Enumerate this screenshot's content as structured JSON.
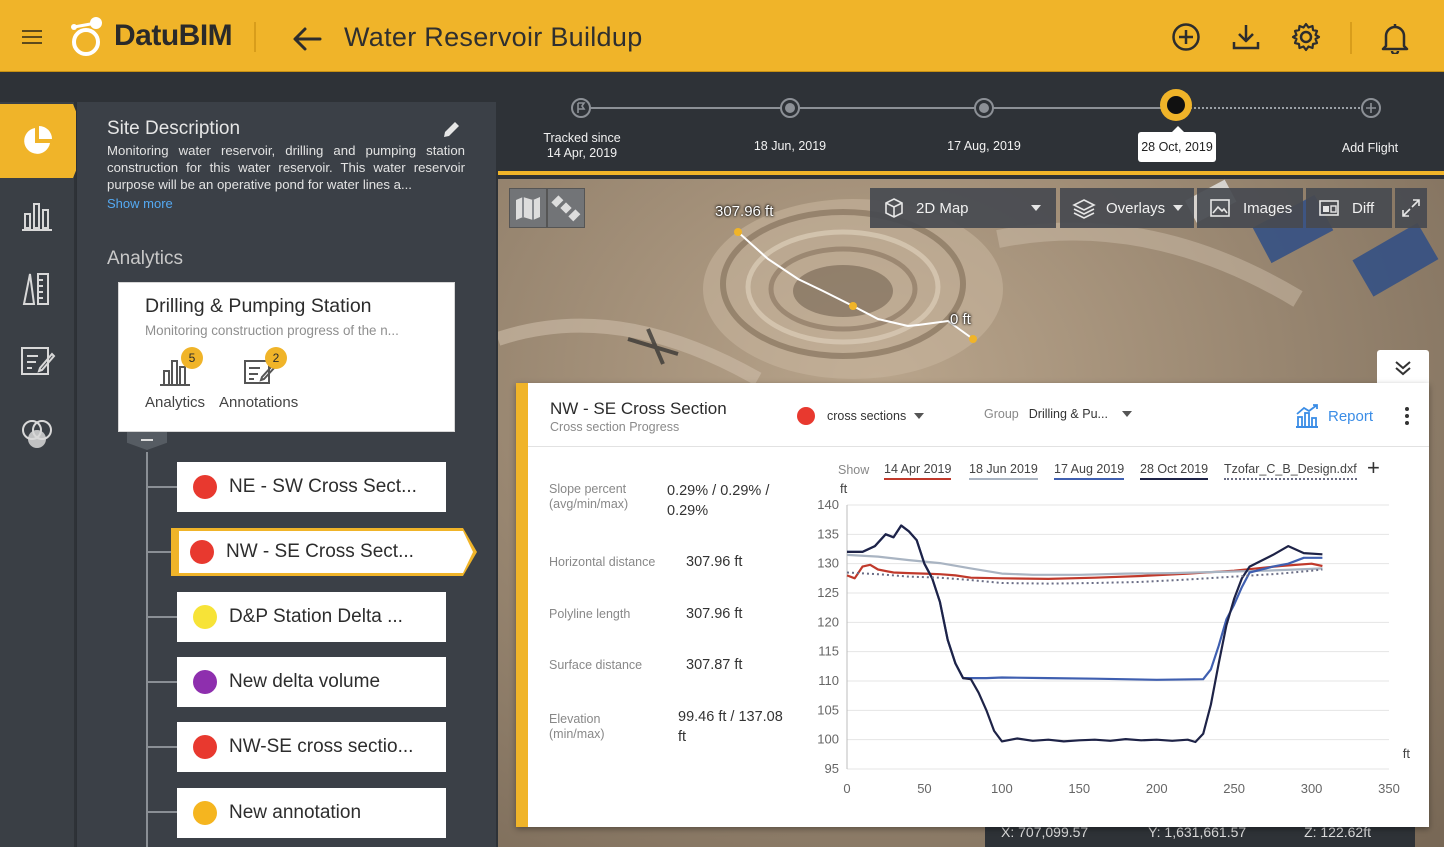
{
  "app": {
    "brand": "DatuBIM",
    "page_title": "Water Reservoir Buildup"
  },
  "icons": {
    "menu": "hamburger-icon",
    "back": "arrow-left-icon",
    "add": "plus-circle-icon",
    "download": "download-icon",
    "settings": "gear-icon",
    "notifications": "bell-icon"
  },
  "site": {
    "title": "Site Description",
    "description": "Monitoring water reservoir, drilling and pumping station construction for this water reservoir. This water reservoir purpose will be an operative pond for water lines a...",
    "show_more": "Show more"
  },
  "analytics": {
    "title": "Analytics",
    "card": {
      "title": "Drilling & Pumping Station",
      "subtitle": "Monitoring construction progress of the n...",
      "analytics_label": "Analytics",
      "analytics_count": "5",
      "annotations_label": "Annotations",
      "annotations_count": "2"
    },
    "items": [
      {
        "label": "NE - SW Cross Sect...",
        "color": "#e8392f"
      },
      {
        "label": "NW - SE Cross Sect...",
        "color": "#e8392f"
      },
      {
        "label": "D&P Station Delta ...",
        "color": "#f7e337"
      },
      {
        "label": "New delta volume",
        "color": "#8e2fae"
      },
      {
        "label": "NW-SE cross sectio...",
        "color": "#e8392f"
      },
      {
        "label": "New annotation",
        "color": "#f5b51f"
      }
    ]
  },
  "timeline": {
    "tracked_line1": "Tracked since",
    "tracked_line2": "14 Apr, 2019",
    "flight2": "18 Jun, 2019",
    "flight3": "17 Aug, 2019",
    "current": "28 Oct, 2019",
    "add_flight": "Add Flight"
  },
  "map": {
    "view_mode": "2D Map",
    "overlays": "Overlays",
    "images": "Images",
    "diff": "Diff",
    "label_start": "307.96 ft",
    "label_end": "0 ft",
    "coord_x": "X: 707,099.57",
    "coord_y": "Y: 1,631,661.57",
    "coord_z": "Z: 122.62ft"
  },
  "cross_section": {
    "title": "NW - SE Cross Section",
    "subtitle": "Cross section Progress",
    "layer": "cross sections",
    "layer_color": "#e8392f",
    "group_label": "Group",
    "group_value": "Drilling & Pu...",
    "report": "Report",
    "stats": [
      {
        "key1": "Slope percent",
        "key2": "(avg/min/max)",
        "val1": "0.29% / 0.29% /",
        "val2": "0.29%"
      },
      {
        "key1": "Horizontal distance",
        "key2": "",
        "val1": "307.96 ft",
        "val2": ""
      },
      {
        "key1": "Polyline length",
        "key2": "",
        "val1": "307.96 ft",
        "val2": ""
      },
      {
        "key1": "Surface distance",
        "key2": "",
        "val1": "307.87 ft",
        "val2": ""
      },
      {
        "key1": "Elevation",
        "key2": "(min/max)",
        "val1": "99.46 ft / 137.08",
        "val2": "ft"
      }
    ],
    "show_label": "Show",
    "legend": [
      {
        "label": "14 Apr 2019",
        "color": "#c0392b"
      },
      {
        "label": "18 Jun 2019",
        "color": "#a9b4c2"
      },
      {
        "label": "17 Aug 2019",
        "color": "#3f5fb0"
      },
      {
        "label": "28 Oct 2019",
        "color": "#1e2347"
      },
      {
        "label": "Tzofar_C_B_Design.dxf",
        "color": "#6a6d85"
      }
    ],
    "add_symbol": "+"
  },
  "chart_data": {
    "type": "line",
    "xlabel": "ft",
    "ylabel": "ft",
    "xlim": [
      0,
      350
    ],
    "ylim": [
      95,
      140
    ],
    "x_ticks": [
      0,
      50,
      100,
      150,
      200,
      250,
      300,
      350
    ],
    "y_ticks": [
      95,
      100,
      105,
      110,
      115,
      120,
      125,
      130,
      135,
      140
    ],
    "grid": true,
    "legend_position": "top",
    "series": [
      {
        "name": "14 Apr 2019",
        "color": "#c0392b",
        "style": "solid",
        "x": [
          0,
          5,
          10,
          15,
          20,
          30,
          40,
          50,
          60,
          70,
          80,
          100,
          130,
          160,
          190,
          220,
          250,
          280,
          300,
          307
        ],
        "y": [
          128,
          127.5,
          129.5,
          129.8,
          129,
          128.5,
          128.4,
          128.3,
          128.2,
          128,
          127.6,
          127.5,
          127.4,
          127.6,
          127.9,
          128.3,
          128.8,
          129.6,
          130,
          129.6
        ]
      },
      {
        "name": "18 Jun 2019",
        "color": "#a9b4c2",
        "style": "solid",
        "x": [
          0,
          20,
          40,
          60,
          80,
          100,
          120,
          150,
          180,
          210,
          240,
          270,
          300,
          307
        ],
        "y": [
          131.5,
          131.2,
          130.6,
          130.1,
          129.2,
          128.3,
          128.1,
          128.1,
          128.3,
          128.4,
          128.6,
          128.8,
          129.1,
          129.2
        ]
      },
      {
        "name": "17 Aug 2019",
        "color": "#3f5fb0",
        "style": "solid",
        "x": [
          0,
          10,
          18,
          25,
          30,
          35,
          40,
          45,
          50,
          55,
          60,
          65,
          70,
          75,
          80,
          90,
          100,
          130,
          160,
          200,
          230,
          235,
          240,
          245,
          250,
          255,
          260,
          275,
          285,
          295,
          307
        ],
        "y": [
          132,
          132,
          133,
          135,
          134.5,
          136.5,
          135.5,
          134,
          130,
          127.5,
          123.5,
          117,
          113,
          110.5,
          110.5,
          110.5,
          110.6,
          110.5,
          110.4,
          110.2,
          110.3,
          112,
          116,
          120.5,
          123,
          126,
          128.5,
          129.5,
          130,
          131,
          131
        ]
      },
      {
        "name": "28 Oct 2019",
        "color": "#1e2347",
        "style": "solid",
        "x": [
          0,
          10,
          18,
          25,
          30,
          35,
          40,
          45,
          50,
          55,
          60,
          65,
          70,
          75,
          80,
          85,
          90,
          95,
          100,
          110,
          120,
          130,
          140,
          150,
          160,
          170,
          180,
          190,
          200,
          210,
          220,
          225,
          230,
          235,
          240,
          245,
          250,
          255,
          260,
          275,
          285,
          295,
          307
        ],
        "y": [
          132,
          132,
          133,
          135,
          134.5,
          136.5,
          135.5,
          134,
          130,
          127.5,
          123.5,
          117,
          113,
          110.5,
          110.3,
          108,
          105,
          101.5,
          99.7,
          100.2,
          99.8,
          100,
          99.7,
          99.9,
          100,
          99.8,
          100.1,
          99.9,
          100,
          99.8,
          100,
          99.6,
          101,
          106,
          113,
          119.5,
          124,
          127.5,
          129.5,
          131.5,
          133,
          131.8,
          131.6
        ]
      },
      {
        "name": "Tzofar_C_B_Design.dxf",
        "color": "#6a6d85",
        "style": "dotted",
        "x": [
          0,
          20,
          40,
          60,
          80,
          100,
          130,
          160,
          190,
          220,
          250,
          280,
          300,
          307
        ],
        "y": [
          128.5,
          128.2,
          127.8,
          127.6,
          127.2,
          126.7,
          126.6,
          126.7,
          126.9,
          127.3,
          127.8,
          128.3,
          128.8,
          129
        ]
      }
    ]
  }
}
